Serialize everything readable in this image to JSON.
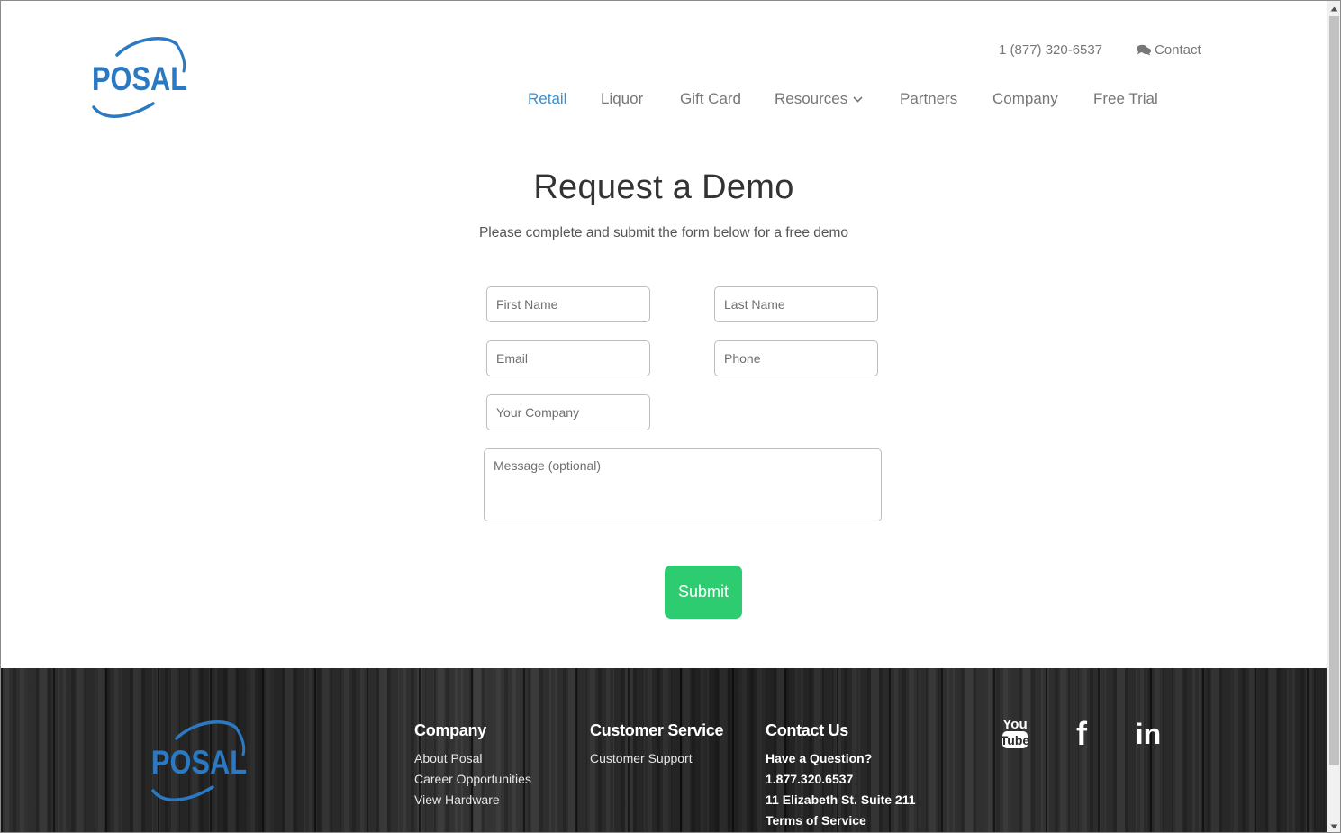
{
  "brand": {
    "logo_text": "POSAL",
    "logo_color": "#2a79c2",
    "accent": "#3a8fd0",
    "cta_color": "#2ecc71"
  },
  "topbar": {
    "phone": "1 (877) 320-6537",
    "contact_label": "Contact",
    "contact_icon": "chat-bubbles-icon"
  },
  "nav": {
    "items": [
      {
        "label": "Retail",
        "active": true
      },
      {
        "label": "Liquor"
      },
      {
        "label": "Gift Card"
      },
      {
        "label": "Resources",
        "dropdown": true
      },
      {
        "label": "Partners"
      },
      {
        "label": "Company"
      },
      {
        "label": "Free Trial"
      }
    ]
  },
  "main": {
    "title": "Request a Demo",
    "subtitle": "Please complete and submit the form below for a free demo",
    "form": {
      "first_name": {
        "placeholder": "First Name",
        "value": ""
      },
      "last_name": {
        "placeholder": "Last Name",
        "value": ""
      },
      "email": {
        "placeholder": "Email",
        "value": ""
      },
      "phone": {
        "placeholder": "Phone",
        "value": ""
      },
      "company": {
        "placeholder": "Your Company",
        "value": ""
      },
      "message": {
        "placeholder": "Message (optional)",
        "value": ""
      },
      "submit_label": "Submit"
    }
  },
  "footer": {
    "logo_text": "POSAL",
    "company": {
      "heading": "Company",
      "links": [
        "About Posal",
        "Career Opportunities",
        "View Hardware"
      ]
    },
    "customer_service": {
      "heading": "Customer Service",
      "links": [
        "Customer Support"
      ]
    },
    "contact": {
      "heading": "Contact Us",
      "lines": [
        "Have a Question?",
        "1.877.320.6537",
        "11 Elizabeth St. Suite 211",
        "Terms of Service"
      ]
    },
    "social": [
      {
        "icon": "youtube-icon",
        "top": "You",
        "bottom": "Tube"
      },
      {
        "icon": "facebook-icon",
        "glyph": "f"
      },
      {
        "icon": "linkedin-icon",
        "glyph": "in"
      }
    ]
  }
}
